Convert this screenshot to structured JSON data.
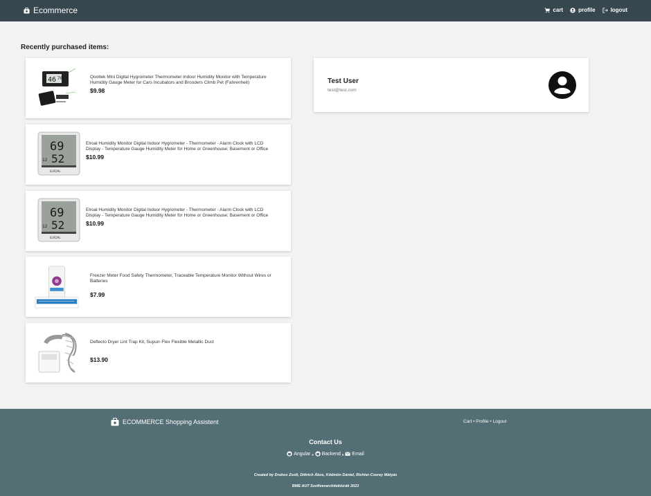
{
  "navbar": {
    "brand": "Ecommerce",
    "links": [
      {
        "label": "cart",
        "icon": "cart-icon"
      },
      {
        "label": "profile",
        "icon": "account-circle-icon"
      },
      {
        "label": "logout",
        "icon": "logout-icon"
      }
    ]
  },
  "main": {
    "section_title": "Recently purchased items:",
    "items": [
      {
        "title": "Qooltek Mini Digital Hygrometer Thermometer Indoor Humidity Monitor with Temperature Humidity Gauge Meter for Cars Incubators and Brooders Climb Pet (Fahrenheit)",
        "price": "$9.98",
        "image": "mini-hygrometer-image"
      },
      {
        "title": "Elroal Humidity Monitor Digital Indoor Hygrometer - Thermometer - Alarm Clock with LCD Display - Temperature Gauge Humidity Meter for Home or Greenhouse, Basement or Office",
        "price": "$10.99",
        "image": "hygrometer-clock-image"
      },
      {
        "title": "Elroal Humidity Monitor Digital Indoor Hygrometer - Thermometer - Alarm Clock with LCD Display - Temperature Gauge Humidity Meter for Home or Greenhouse, Basement or Office",
        "price": "$10.99",
        "image": "hygrometer-clock-image"
      },
      {
        "title": "Freezer Meter Food Safety Thermometer, Traceable Temperature Monitor Without Wires or Batteries",
        "price": "$7.99",
        "image": "freezer-thermometer-image"
      },
      {
        "title": "Deflecto Dryer Lint Trap Kit, Supurr-Flex Flexible Metallic Duct",
        "price": "$13.90",
        "image": "dryer-duct-image"
      }
    ]
  },
  "profile": {
    "name": "Test User",
    "email": "test@test.com",
    "avatar_icon": "account-circle-icon"
  },
  "footer": {
    "brand": "ECOMMERCE Shopping Assistent",
    "links_text": "Cart • Profile • Logout",
    "contact_title": "Contact Us",
    "contact_links": [
      {
        "label": "Angular",
        "icon": "github-icon"
      },
      {
        "label": "Backend",
        "icon": "github-icon"
      },
      {
        "label": "Email",
        "icon": "envelope-icon"
      }
    ],
    "separator": "•",
    "credits": "Created by Drahos Zsolt, Dittrich Ákos, Ködmön Dániel, Richter-Cserey Mátyás",
    "course": "BME AUT Szoftverarchitektúrák 2023"
  },
  "colors": {
    "navbar": "#37474f",
    "footer": "#546e75",
    "page_background": "#f2f2f2"
  }
}
